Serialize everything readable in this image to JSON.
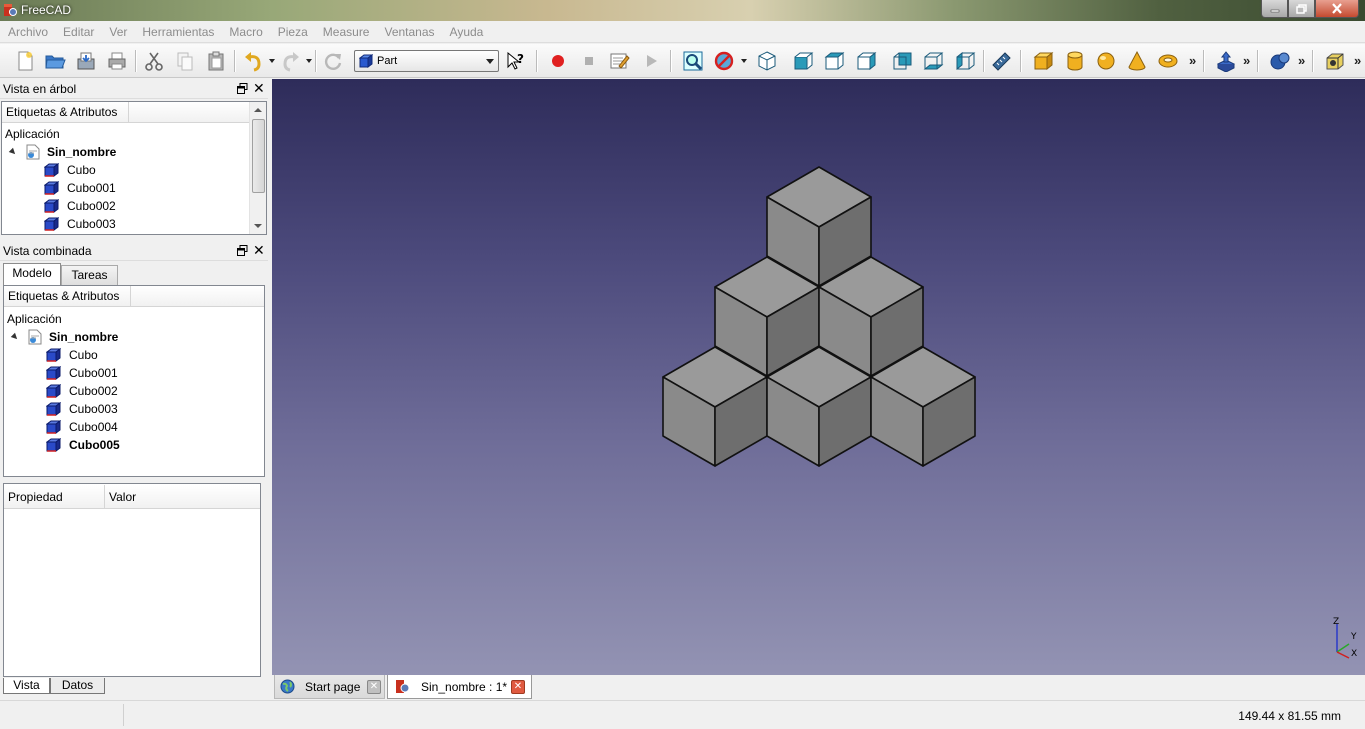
{
  "window": {
    "title": "FreeCAD"
  },
  "menu": [
    "Archivo",
    "Editar",
    "Ver",
    "Herramientas",
    "Macro",
    "Pieza",
    "Measure",
    "Ventanas",
    "Ayuda"
  ],
  "toolbar": {
    "workbench": "Part",
    "more": "»"
  },
  "tree_view": {
    "title": "Vista en árbol",
    "header": "Etiquetas & Atributos",
    "root": "Aplicación",
    "document": "Sin_nombre",
    "items": [
      "Cubo",
      "Cubo001",
      "Cubo002",
      "Cubo003"
    ]
  },
  "combo_view": {
    "title": "Vista combinada",
    "tabs": [
      "Modelo",
      "Tareas"
    ],
    "header": "Etiquetas & Atributos",
    "root": "Aplicación",
    "document": "Sin_nombre",
    "items": [
      "Cubo",
      "Cubo001",
      "Cubo002",
      "Cubo003",
      "Cubo004",
      "Cubo005"
    ],
    "property_header": {
      "name": "Propiedad",
      "value": "Valor"
    },
    "bottom_tabs": [
      "Vista",
      "Datos"
    ]
  },
  "documents": {
    "tabs": [
      "Start page",
      "Sin_nombre : 1*"
    ]
  },
  "axis_labels": {
    "x": "X",
    "y": "Y",
    "z": "Z"
  },
  "status": {
    "dimensions": "149.44 x 81.55 mm"
  },
  "colors": {
    "accent_red": "#d63a1f",
    "cube_face_top": "#9a9a9a",
    "cube_face_left": "#8a8a8a",
    "cube_face_right": "#6e6e6e"
  }
}
